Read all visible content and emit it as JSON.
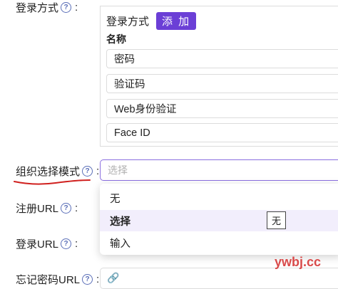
{
  "login_methods": {
    "label": "登录方式",
    "panel_title": "登录方式",
    "add_label": "添 加",
    "column_header": "名称",
    "items": [
      "密码",
      "验证码",
      "Web身份验证",
      "Face ID"
    ]
  },
  "org_select_mode": {
    "label": "组织选择模式",
    "placeholder": "选择",
    "options": [
      {
        "label": "无",
        "selected": false
      },
      {
        "label": "选择",
        "selected": true
      },
      {
        "label": "输入",
        "selected": false
      }
    ],
    "tooltip": "无"
  },
  "signup_url": {
    "label": "注册URL"
  },
  "signin_url": {
    "label": "登录URL"
  },
  "forget_url": {
    "label": "忘记密码URL"
  },
  "watermark": "ywbj.cc",
  "colors": {
    "accent": "#6b3fd6",
    "selected_bg": "#f2eefc",
    "underline": "#d0201e"
  }
}
